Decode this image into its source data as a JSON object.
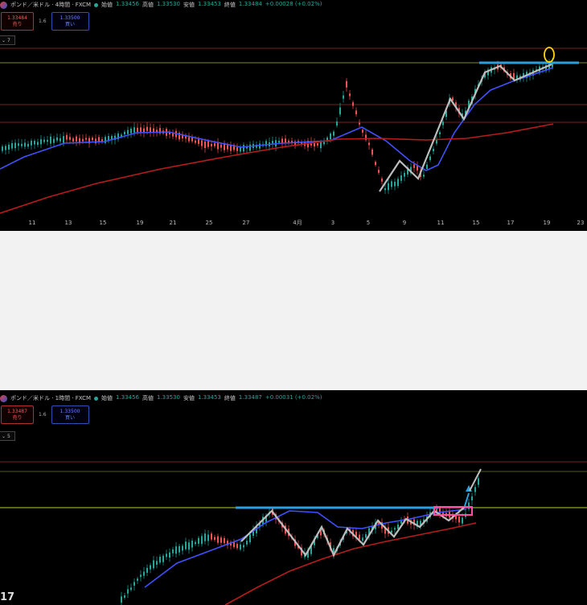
{
  "colors": {
    "background": "#000000",
    "up": "#26a69a",
    "down": "#ef5350",
    "ma_fast": "#3f51ff",
    "ma_slow": "#b71c1c",
    "zigzag": "#bdbdbd",
    "resistance": "#2aa0e0",
    "marker": "#ffd600",
    "box": "#ff4fa3"
  },
  "top": {
    "symbol": "ポンド／米ドル · 4時間 · FXCM",
    "ohlc": {
      "open_label": "始値",
      "open": "1.33456",
      "high_label": "高値",
      "high": "1.33530",
      "low_label": "安値",
      "low": "1.33453",
      "close_label": "終値",
      "close": "1.33484",
      "change": "+0.00028 (+0.02%)"
    },
    "sell_price": "1.33484",
    "sell_label": "売り",
    "spread": "1.6",
    "buy_price": "1.33500",
    "buy_label": "買い",
    "indicator_count": "7",
    "x_ticks": [
      "11",
      "13",
      "15",
      "19",
      "21",
      "25",
      "27",
      "4月",
      "3",
      "5",
      "9",
      "11",
      "15",
      "17",
      "19",
      "23"
    ]
  },
  "bottom": {
    "symbol": "ポンド／米ドル · 1時間 · FXCM",
    "ohlc": {
      "open_label": "始値",
      "open": "1.33456",
      "high_label": "高値",
      "high": "1.33530",
      "low_label": "安値",
      "low": "1.33453",
      "close_label": "終値",
      "close": "1.33487",
      "change": "+0.00031 (+0.02%)"
    },
    "sell_price": "1.33487",
    "sell_label": "売り",
    "spread": "1.6",
    "buy_price": "1.33500",
    "buy_label": "買い",
    "indicator_count": "5",
    "logo": "17"
  }
}
